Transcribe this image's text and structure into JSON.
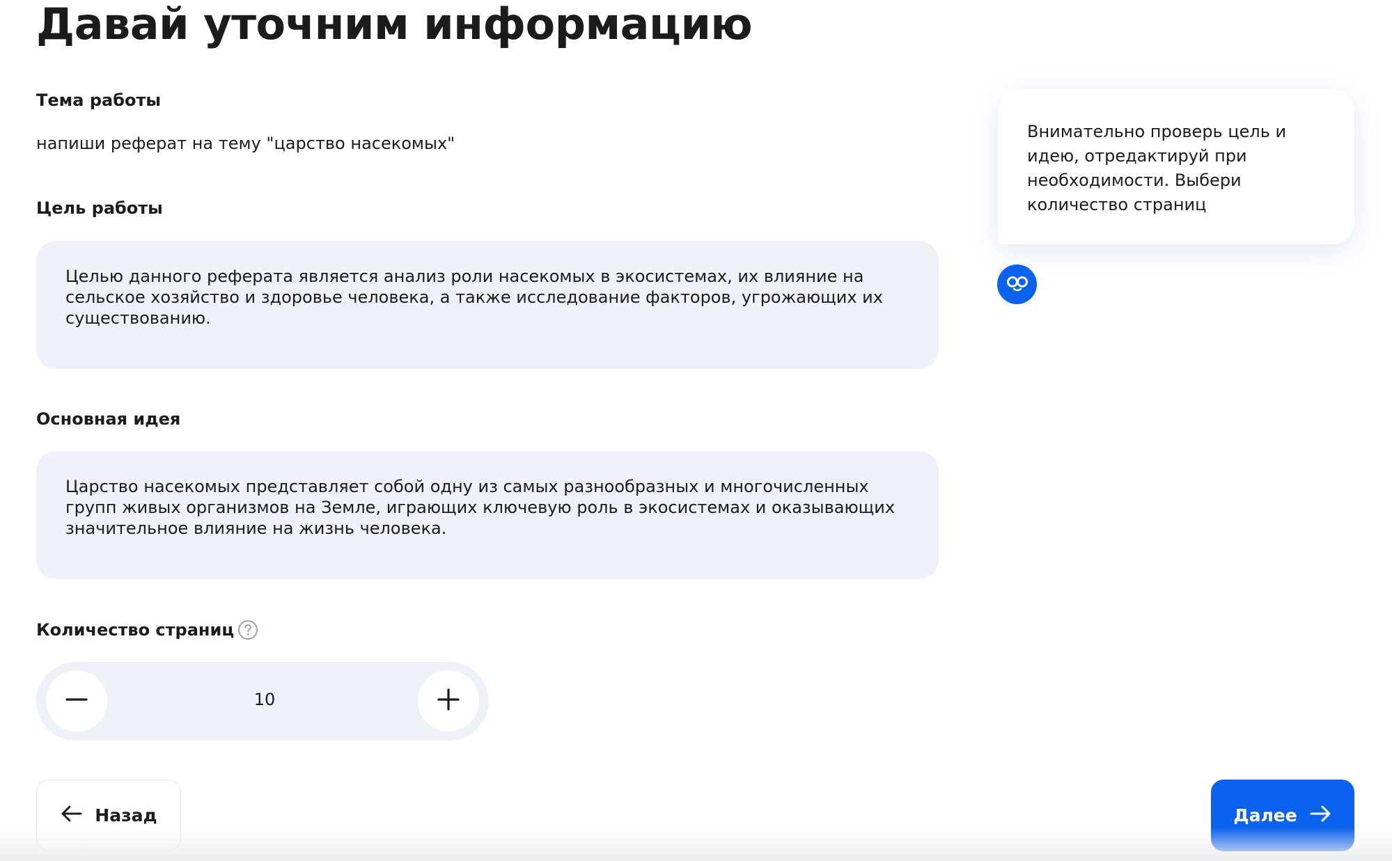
{
  "page": {
    "title": "Давай уточним информацию"
  },
  "topic": {
    "label": "Тема работы",
    "value": "напиши реферат на тему \"царство насекомых\""
  },
  "goal": {
    "label": "Цель работы",
    "value": "Целью данного реферата является анализ роли насекомых в экосистемах, их влияние на сельское хозяйство и здоровье человека, а также исследование факторов, угрожающих их существованию."
  },
  "main_idea": {
    "label": "Основная идея",
    "value": "Царство насекомых представляет собой одну из самых разнообразных и многочисленных групп живых организмов на Земле, играющих ключевую роль в экосистемах и оказывающих значительное влияние на жизнь человека."
  },
  "pages": {
    "label": "Количество страниц",
    "value": "10"
  },
  "hint": {
    "text": "Внимательно проверь цель и идею, отредактируй при необходимости. Выбери количество страниц"
  },
  "nav": {
    "back_label": "Назад",
    "next_label": "Далее"
  },
  "icons": {
    "help": "question-circle-icon",
    "avatar": "assistant-logo-icon",
    "minus": "minus-icon",
    "plus": "plus-icon",
    "back": "arrow-left-icon",
    "next": "arrow-right-icon"
  },
  "colors": {
    "accent": "#0a62ee",
    "field_background": "#eef2f8",
    "text": "#1c1c1e"
  }
}
